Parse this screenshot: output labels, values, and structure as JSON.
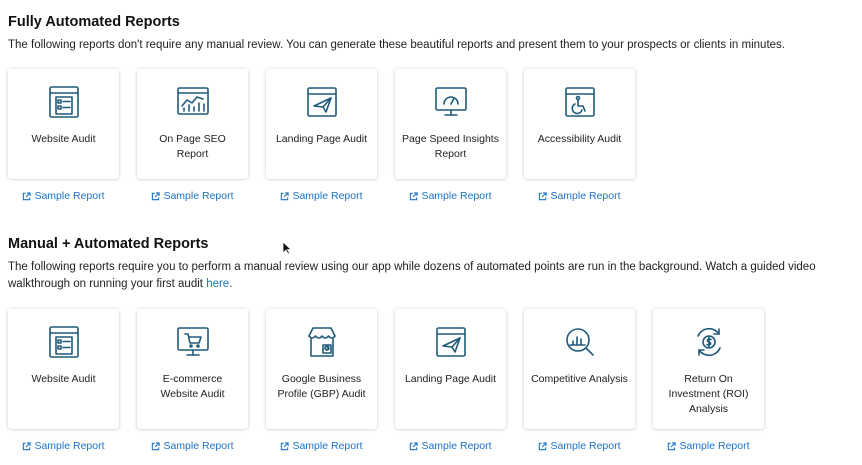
{
  "sections": [
    {
      "title": "Fully Automated Reports",
      "description": "The following reports don't require any manual review. You can generate these beautiful reports and present them to your prospects or clients in minutes.",
      "cards": [
        {
          "label": "Website Audit",
          "icon": "website-audit-icon",
          "link": "Sample Report"
        },
        {
          "label": "On Page SEO Report",
          "icon": "seo-chart-icon",
          "link": "Sample Report"
        },
        {
          "label": "Landing Page Audit",
          "icon": "landing-page-plane-icon",
          "link": "Sample Report"
        },
        {
          "label": "Page Speed Insights Report",
          "icon": "speedometer-icon",
          "link": "Sample Report"
        },
        {
          "label": "Accessibility Audit",
          "icon": "accessibility-icon",
          "link": "Sample Report"
        }
      ]
    },
    {
      "title": "Manual + Automated Reports",
      "description": "The following reports require you to perform a manual review using our app while dozens of automated points are run in the background. Watch a guided video walkthrough on running your first audit",
      "link_text": "here",
      "link_suffix": ".",
      "cards": [
        {
          "label": "Website Audit",
          "icon": "website-audit-icon",
          "link": "Sample Report"
        },
        {
          "label": "E-commerce Website Audit",
          "icon": "ecommerce-cart-icon",
          "link": "Sample Report"
        },
        {
          "label": "Google Business Profile (GBP) Audit",
          "icon": "storefront-icon",
          "link": "Sample Report"
        },
        {
          "label": "Landing Page Audit",
          "icon": "landing-page-plane-icon",
          "link": "Sample Report"
        },
        {
          "label": "Competitive Analysis",
          "icon": "magnifier-chart-icon",
          "link": "Sample Report"
        },
        {
          "label": "Return On Investment (ROI) Analysis",
          "icon": "roi-dollar-icon",
          "link": "Sample Report"
        }
      ]
    }
  ],
  "colors": {
    "icon": "#1f5a7a",
    "link": "#1a73c8"
  }
}
